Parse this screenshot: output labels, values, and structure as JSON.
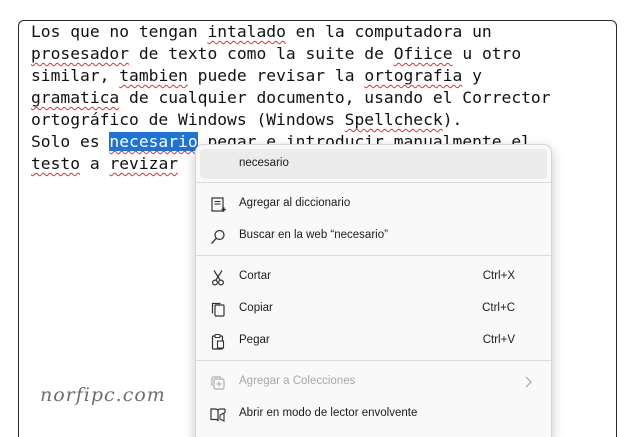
{
  "editor": {
    "lines": [
      [
        {
          "t": "Los que no tengan "
        },
        {
          "t": "intalado",
          "s": 1
        },
        {
          "t": " en la computadora un"
        }
      ],
      [
        {
          "t": "prosesador",
          "s": 1
        },
        {
          "t": " de texto como la suite de "
        },
        {
          "t": "Ofiice",
          "s": 1
        },
        {
          "t": " u otro"
        }
      ],
      [
        {
          "t": "similar, "
        },
        {
          "t": "tambien",
          "s": 1
        },
        {
          "t": " puede revisar la "
        },
        {
          "t": "ortografia",
          "s": 1
        },
        {
          "t": " y"
        }
      ],
      [
        {
          "t": "gramatica",
          "s": 1
        },
        {
          "t": " de cualquier documento, usando el Corrector"
        }
      ],
      [
        {
          "t": "ortográfico de Windows (Windows "
        },
        {
          "t": "Spellcheck",
          "s": 1
        },
        {
          "t": ")."
        }
      ],
      [
        {
          "t": "Solo es "
        },
        {
          "t": "necesario",
          "sel": 1
        },
        {
          "t": " pegar e introducir manualmente el"
        }
      ],
      [
        {
          "t": "testo",
          "s": 1
        },
        {
          "t": " a "
        },
        {
          "t": "revizar",
          "s": 1
        }
      ]
    ]
  },
  "watermark": "norfipc.com",
  "context_menu": {
    "suggestion": "necesario",
    "add_to_dictionary": "Agregar al diccionario",
    "search_web": "Buscar en la web “necesario”",
    "cut": "Cortar",
    "cut_shortcut": "Ctrl+X",
    "copy": "Copiar",
    "copy_shortcut": "Ctrl+C",
    "paste": "Pegar",
    "paste_shortcut": "Ctrl+V",
    "add_to_collections": "Agregar a Colecciones",
    "immersive_reader": "Abrir en modo de lector envolvente"
  },
  "icons": {
    "dictionary": "add-to-dictionary-icon",
    "search": "search-icon",
    "cut": "scissors-icon",
    "copy": "copy-icon",
    "paste": "clipboard-icon",
    "collections": "collections-icon",
    "reader": "immersive-reader-icon",
    "submenu": "chevron-right-icon"
  },
  "colors": {
    "selection": "#1e73d7",
    "spell_error": "#e0322b",
    "disabled_text": "#a8a8a8"
  }
}
